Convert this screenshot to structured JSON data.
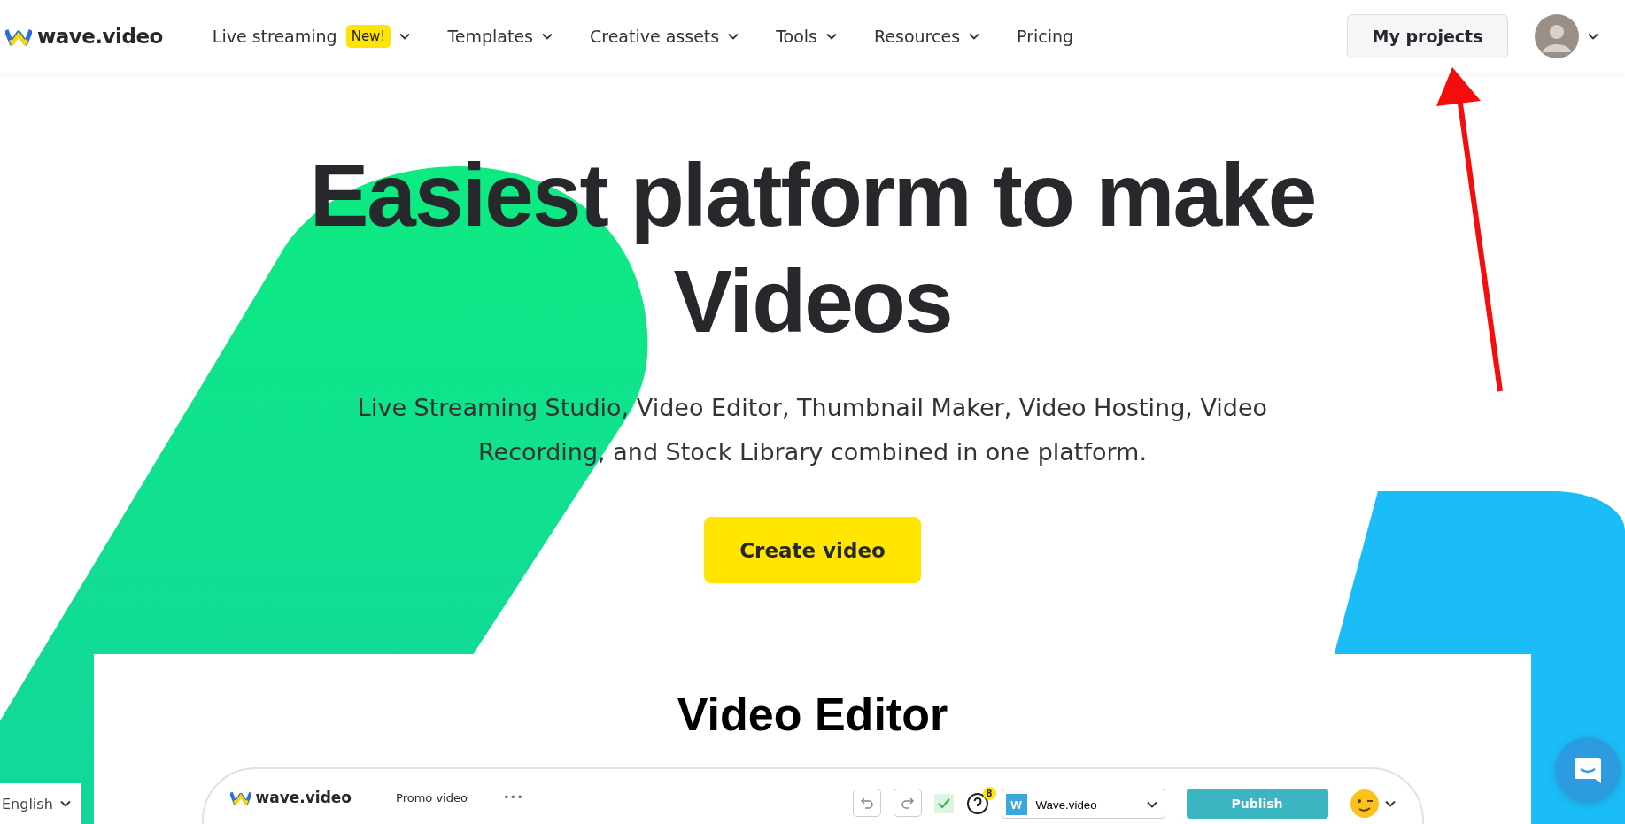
{
  "header": {
    "logo": "wave.video",
    "nav": [
      {
        "label": "Live streaming",
        "badge": "New!",
        "dropdown": true
      },
      {
        "label": "Templates",
        "dropdown": true
      },
      {
        "label": "Creative assets",
        "dropdown": true
      },
      {
        "label": "Tools",
        "dropdown": true
      },
      {
        "label": "Resources",
        "dropdown": true
      },
      {
        "label": "Pricing",
        "dropdown": false
      }
    ],
    "my_projects": "My projects"
  },
  "hero": {
    "title": "Easiest platform to make Videos",
    "subtitle": "Live Streaming Studio, Video Editor, Thumbnail Maker, Video Hosting, Video Recording, and Stock Library combined in one platform.",
    "cta": "Create video"
  },
  "editor_card": {
    "title": "Video Editor",
    "mock_toolbar": {
      "logo": "wave.video",
      "project": "Promo video",
      "more": "•••",
      "help_badge": "8",
      "workspace_initial": "W",
      "workspace": "Wave.video",
      "publish": "Publish"
    }
  },
  "language": "English"
}
